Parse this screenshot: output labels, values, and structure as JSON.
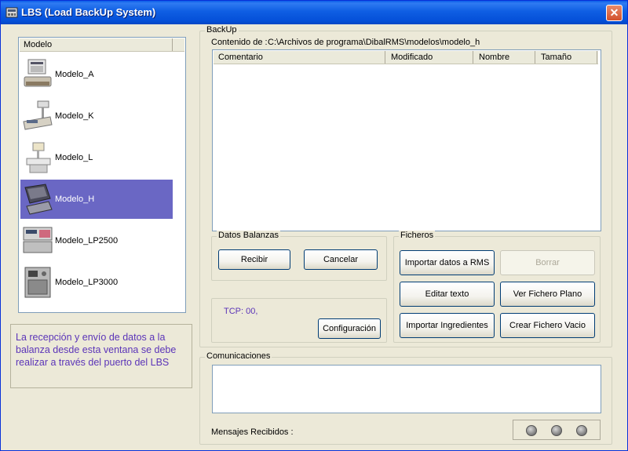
{
  "window": {
    "title": "LBS (Load BackUp System)",
    "close_glyph": "✕"
  },
  "models": {
    "header": "Modelo",
    "items": [
      {
        "label": "Modelo_A",
        "icon": "scale-a-icon"
      },
      {
        "label": "Modelo_K",
        "icon": "scale-k-icon"
      },
      {
        "label": "Modelo_L",
        "icon": "scale-l-icon"
      },
      {
        "label": "Modelo_H",
        "icon": "scale-h-icon",
        "selected": true
      },
      {
        "label": "Modelo_LP2500",
        "icon": "scale-lp2500-icon"
      },
      {
        "label": "Modelo_LP3000",
        "icon": "scale-lp3000-icon"
      }
    ]
  },
  "info_text": "La recepción y envío de datos a la balanza desde esta ventana se debe realizar a través del puerto del LBS",
  "backup": {
    "title": "BackUp",
    "path_label": "Contenido de :",
    "path_value": "C:\\Archivos de programa\\DibalRMS\\modelos\\modelo_h",
    "columns": [
      "Comentario",
      "Modificado",
      "Nombre",
      "Tamaño"
    ]
  },
  "datos_balanzas": {
    "title": "Datos Balanzas",
    "recibir": "Recibir",
    "cancelar": "Cancelar"
  },
  "tcp": {
    "status": "TCP: 00,",
    "config_button": "Configuración"
  },
  "ficheros": {
    "title": "Ficheros",
    "importar_rms": "Importar datos a RMS",
    "borrar": "Borrar",
    "editar_texto": "Editar texto",
    "ver_fichero": "Ver Fichero Plano",
    "importar_ingredientes": "Importar Ingredientes",
    "crear_fichero": "Crear Fichero Vacio"
  },
  "comunicaciones": {
    "title": "Comunicaciones",
    "mensajes_label": "Mensajes Recibidos :"
  },
  "colors": {
    "selection": "#6a67c4",
    "info_text": "#5b34b8",
    "titlebar": "#0a5ce8"
  }
}
